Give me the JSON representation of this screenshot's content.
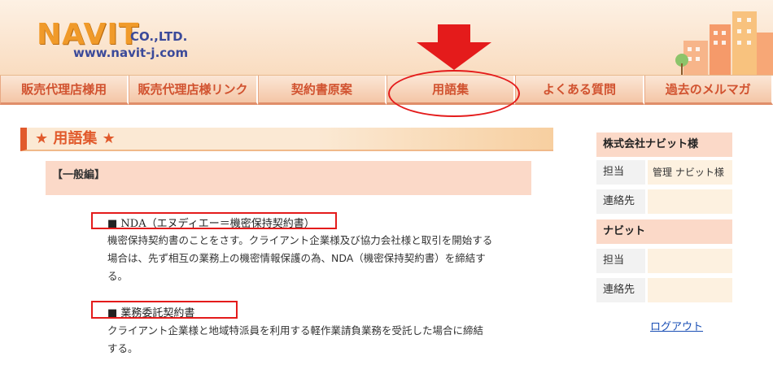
{
  "header": {
    "logo_main": "NAVIT",
    "logo_co": "CO.,LTD.",
    "logo_url": "www.navit-j.com"
  },
  "nav": {
    "items": [
      {
        "label": "販売代理店様用"
      },
      {
        "label": "販売代理店様リンク"
      },
      {
        "label": "契約書原案"
      },
      {
        "label": "用語集"
      },
      {
        "label": "よくある質問"
      },
      {
        "label": "過去のメルマガ"
      }
    ]
  },
  "main": {
    "section_title": "★ 用語集 ★",
    "category": "【一般編】",
    "terms": [
      {
        "term": "■ NDA（エヌディエー＝機密保持契約書）",
        "lines": [
          "機密保持契約書のことをさす。クライアント企業様及び協力会社様と取引を開始する",
          "場合は、先ず相互の業務上の機密情報保護の為、NDA（機密保持契約書）を締結す",
          "る。"
        ]
      },
      {
        "term": "■ 業務委託契約書",
        "lines": [
          "クライアント企業様と地域特派員を利用する軽作業請負業務を受託した場合に締結",
          "する。"
        ]
      }
    ]
  },
  "sidebar": {
    "company_header": "株式会社ナビット様",
    "company_rows": [
      {
        "label": "担当",
        "value": "管理 ナビット様"
      },
      {
        "label": "連絡先",
        "value": ""
      }
    ],
    "navit_header": "ナビット",
    "navit_rows": [
      {
        "label": "担当",
        "value": ""
      },
      {
        "label": "連絡先",
        "value": ""
      }
    ],
    "logout_label": "ログアウト"
  },
  "colors": {
    "accent": "#e15a2c",
    "highlight_red": "#e41b1b",
    "nav_text": "#d1522f",
    "link": "#1a4fb5"
  }
}
